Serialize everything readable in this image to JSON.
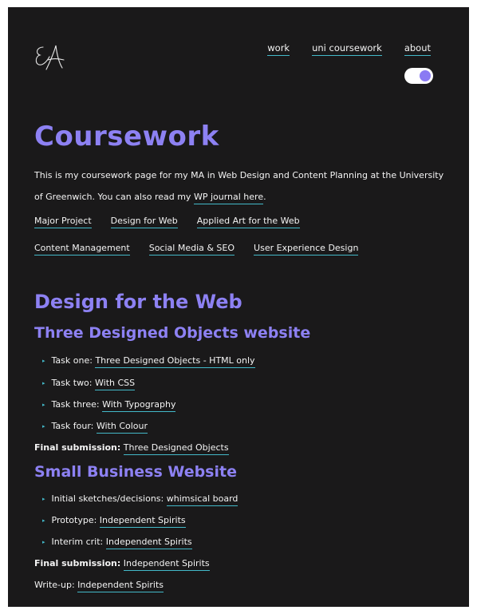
{
  "nav": {
    "items": [
      "work",
      "uni coursework",
      "about"
    ]
  },
  "page": {
    "title": "Coursework",
    "intro_text": "This is my coursework page for my MA in Web Design and Content Planning at the University of Greenwich. You can also read my ",
    "intro_link": "WP journal here",
    "intro_end": "."
  },
  "course_links": {
    "row1": [
      "Major Project",
      "Design for Web",
      "Applied Art for the Web"
    ],
    "row2": [
      "Content Management",
      "Social Media & SEO",
      "User Experience Design"
    ]
  },
  "section": {
    "title": "Design for the Web",
    "three_objects": {
      "title": "Three Designed Objects website",
      "tasks": [
        {
          "label": "Task one: ",
          "link": "Three Designed Objects - HTML only"
        },
        {
          "label": "Task two: ",
          "link": "With CSS"
        },
        {
          "label": "Task three: ",
          "link": "With Typography"
        },
        {
          "label": "Task four: ",
          "link": "With Colour"
        }
      ],
      "final_label": "Final submission:",
      "final_link": "Three Designed Objects"
    },
    "small_business": {
      "title": "Small Business Website",
      "tasks": [
        {
          "label": "Initial sketches/decisions: ",
          "link": "whimsical board"
        },
        {
          "label": "Prototype: ",
          "link": "Independent Spirits"
        },
        {
          "label": "Interim crit: ",
          "link": "Independent Spirits"
        }
      ],
      "final_label": "Final submission:",
      "final_link": "Independent Spirits",
      "writeup_label": "Write-up: ",
      "writeup_link": "Independent Spirits"
    }
  },
  "colors": {
    "background": "#1a191a",
    "accent": "#8d81f3",
    "link_underline": "#43b9c9",
    "text": "#f4f4f4"
  },
  "icons": {
    "logo": "signature-logo-icon",
    "bullet": "triangle-bullet-icon",
    "toggle": "theme-toggle"
  }
}
